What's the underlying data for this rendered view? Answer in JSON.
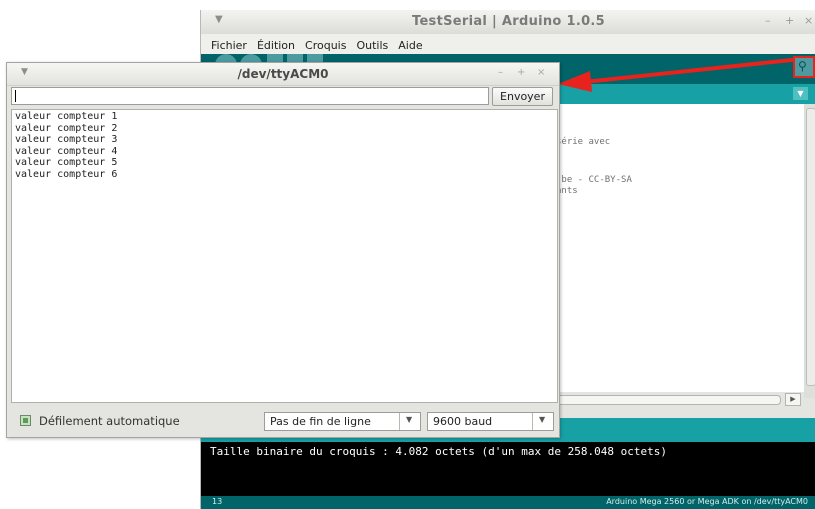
{
  "ide": {
    "title": "TestSerial | Arduino 1.0.5",
    "menu": [
      "Fichier",
      "Édition",
      "Croquis",
      "Outils",
      "Aide"
    ],
    "code_fragments": [
      "série avec",
      ".be - CC-BY-SA",
      "ants"
    ],
    "console_text": "Taille binaire du croquis : 4.082 octets (d'un max de 258.048 octets)",
    "line_number": "13",
    "board_status": "Arduino Mega 2560 or Mega ADK on /dev/ttyACM0",
    "serial_monitor_icon": "magnifier-icon"
  },
  "serial_monitor": {
    "title": "/dev/ttyACM0",
    "input_value": "",
    "send_label": "Envoyer",
    "output_lines": [
      "valeur compteur 1",
      "valeur compteur 2",
      "valeur compteur 3",
      "valeur compteur 4",
      "valeur compteur 5",
      "valeur compteur 6"
    ],
    "autoscroll_label": "Défilement automatique",
    "autoscroll_checked": true,
    "line_ending": "Pas de fin de ligne",
    "baud_rate": "9600 baud"
  },
  "colors": {
    "arduino_teal_dark": "#006468",
    "arduino_teal": "#17a1a5",
    "annotation_red": "#e8221c"
  }
}
